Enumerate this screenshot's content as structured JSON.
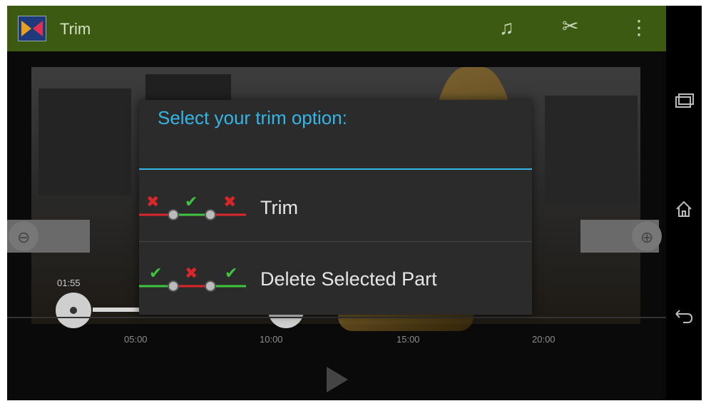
{
  "actionbar": {
    "title": "Trim",
    "icons": [
      "music-note-icon",
      "scissors-icon",
      "overflow-menu-icon"
    ]
  },
  "navbar": {
    "icons": [
      "recent-apps-icon",
      "home-icon",
      "back-icon"
    ]
  },
  "player": {
    "current_time": "01:55",
    "ticks": [
      "05:00",
      "10:00",
      "15:00",
      "20:00"
    ]
  },
  "dialog": {
    "title": "Select your trim option:",
    "options": [
      {
        "label": "Trim",
        "icon": "trim-option-icon"
      },
      {
        "label": "Delete Selected Part",
        "icon": "delete-part-option-icon"
      }
    ]
  },
  "colors": {
    "accent": "#35b5e5",
    "actionbar": "#3c5a12",
    "dialog_bg": "#2b2b2b",
    "keep": "#3ec43e",
    "remove": "#d8262a"
  }
}
